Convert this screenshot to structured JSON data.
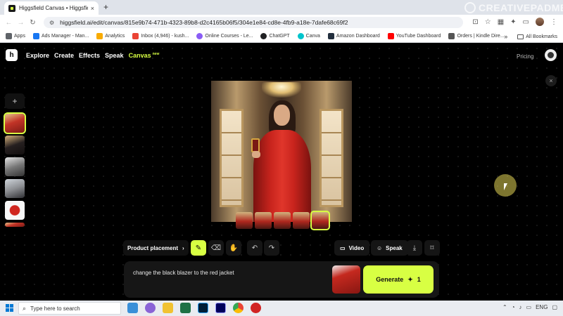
{
  "browser": {
    "tab_title": "Higgsfield Canvas • Higgsfield",
    "tab_close": "×",
    "new_tab": "+",
    "watermark": "CREATIVEPADMEDIA",
    "url": "higgsfield.ai/edit/canvas/815e9b74-471b-4323-89b8-d2c4165b06f5/304e1e84-cd8e-4fb9-a18e-7dafe68c69f2",
    "bookmarks": [
      {
        "label": "Apps",
        "color": "#5f6368"
      },
      {
        "label": "Ads Manager - Man...",
        "color": "#1877f2"
      },
      {
        "label": "Analytics",
        "color": "#f9ab00"
      },
      {
        "label": "Inbox (4,946) - kush...",
        "color": "#ea4335"
      },
      {
        "label": "Online Courses - Le...",
        "color": "#8a5cf5"
      },
      {
        "label": "ChatGPT",
        "color": "#202123"
      },
      {
        "label": "Canva",
        "color": "#00c4cc"
      },
      {
        "label": "Amazon Dashboard",
        "color": "#232f3e"
      },
      {
        "label": "YouTube Dashboard",
        "color": "#ff0000"
      },
      {
        "label": "Orders | Kindle Dire...",
        "color": "#555555"
      }
    ],
    "bookmarks_overflow": "»",
    "all_bookmarks": "All Bookmarks"
  },
  "app": {
    "logo_glyph": "h",
    "nav": [
      {
        "label": "Explore"
      },
      {
        "label": "Create"
      },
      {
        "label": "Effects"
      },
      {
        "label": "Speak"
      },
      {
        "label": "Canvas",
        "badge": "new"
      }
    ],
    "pricing": "Pricing",
    "close_glyph": "×",
    "add_glyph": "+",
    "toolbar": {
      "mode_label": "Product placement",
      "mode_chevron": "›",
      "video_label": "Video",
      "speak_label": "Speak"
    },
    "prompt": {
      "text": "change the black blazer to the red jacket",
      "generate_label": "Generate",
      "generate_cost": "1"
    }
  },
  "taskbar": {
    "search_placeholder": "Type here to search",
    "language": "ENG"
  }
}
